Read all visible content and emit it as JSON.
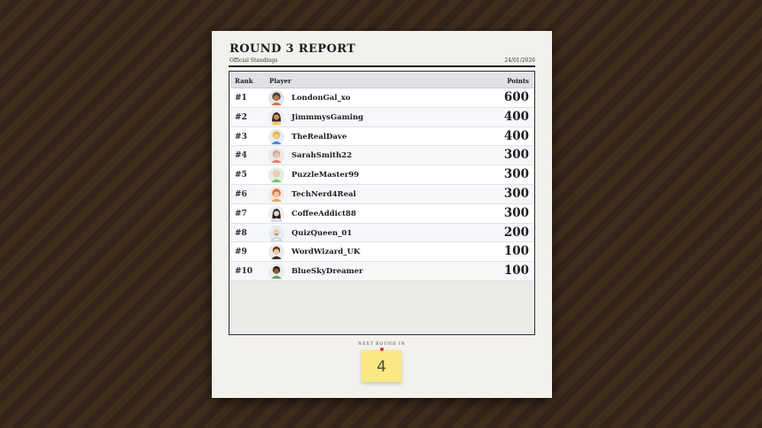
{
  "report": {
    "title": "ROUND 3 REPORT",
    "subtitle": "Official Standings",
    "date": "24/01/2026"
  },
  "table": {
    "headers": {
      "rank": "Rank",
      "player": "Player",
      "points": "Points"
    },
    "rows": [
      {
        "rank": "#1",
        "player": "LondonGal_xo",
        "points": "600",
        "avatar": "avatar-icon-dark-curly-hair"
      },
      {
        "rank": "#2",
        "player": "JimmmysGaming",
        "points": "400",
        "avatar": "avatar-icon-long-dark-hair"
      },
      {
        "rank": "#3",
        "player": "TheRealDave",
        "points": "400",
        "avatar": "avatar-icon-blonde-hair"
      },
      {
        "rank": "#4",
        "player": "SarahSmith22",
        "points": "300",
        "avatar": "avatar-icon-gray-hair"
      },
      {
        "rank": "#5",
        "player": "PuzzleMaster99",
        "points": "300",
        "avatar": "avatar-icon-green-shirt"
      },
      {
        "rank": "#6",
        "player": "TechNerd4Real",
        "points": "300",
        "avatar": "avatar-icon-red-curly-hair"
      },
      {
        "rank": "#7",
        "player": "CoffeeAddict88",
        "points": "300",
        "avatar": "avatar-icon-dark-long-hair"
      },
      {
        "rank": "#8",
        "player": "QuizQueen_01",
        "points": "200",
        "avatar": "avatar-icon-bald-mustache"
      },
      {
        "rank": "#9",
        "player": "WordWizard_UK",
        "points": "100",
        "avatar": "avatar-icon-brown-hair"
      },
      {
        "rank": "#10",
        "player": "BlueSkyDreamer",
        "points": "100",
        "avatar": "avatar-icon-dark-skin"
      }
    ]
  },
  "next_round": {
    "label": "NEXT ROUND IN",
    "countdown": "4"
  },
  "colors": {
    "background": "#3b2a1a",
    "paper": "#f3f1ec",
    "sticky_note": "#fbe882",
    "pin": "#d33a2c",
    "ink": "#1c1c24"
  }
}
